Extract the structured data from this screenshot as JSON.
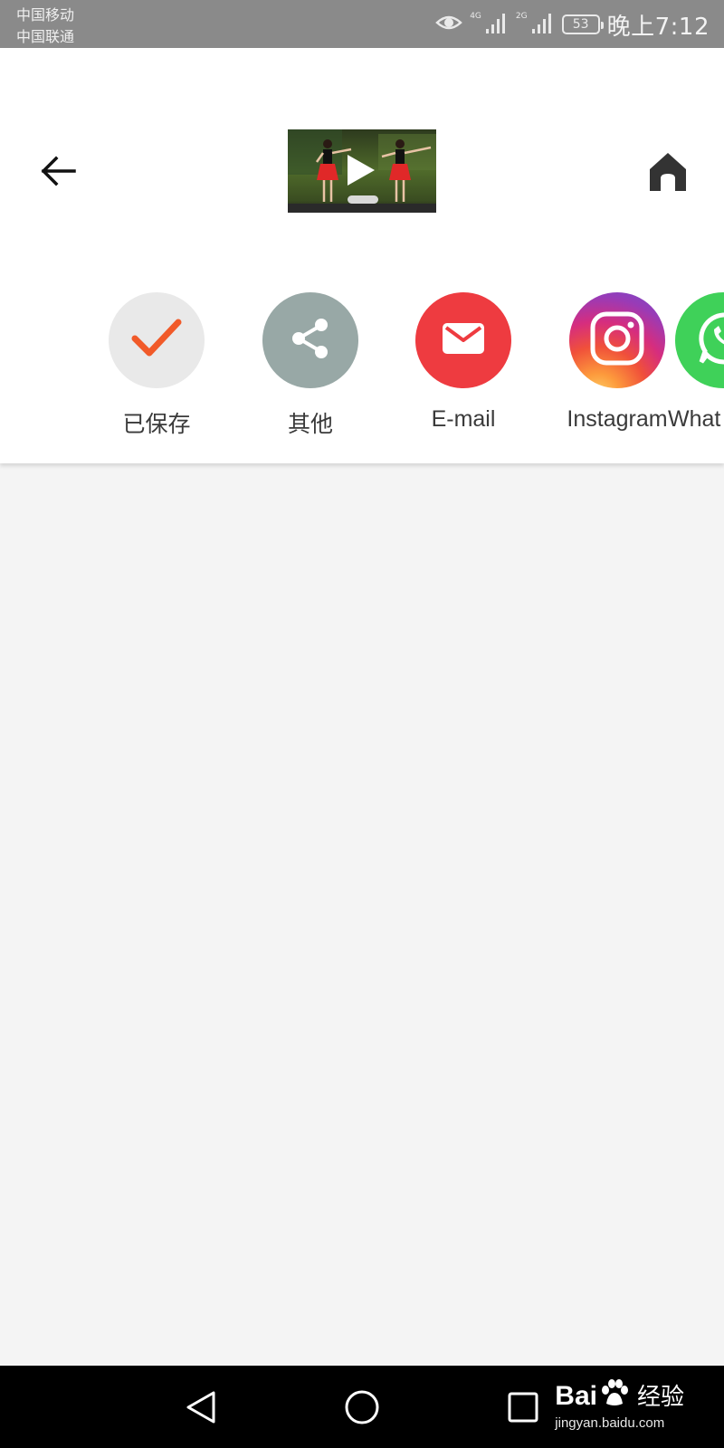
{
  "status_bar": {
    "carrier_1": "中国移动",
    "carrier_2": "中国联通",
    "network_1": "4G",
    "network_2": "2G",
    "battery": "53",
    "time": "晚上7:12",
    "icons": [
      "eye-icon",
      "signal-icon",
      "signal-icon",
      "battery-icon"
    ]
  },
  "header": {
    "back_icon": "arrow-left-icon",
    "home_icon": "home-icon",
    "thumbnail_icon": "play-icon"
  },
  "share_targets": [
    {
      "label": "已保存",
      "icon": "checkmark-icon",
      "color": "#e9e9e9",
      "icon_color": "#f15a29"
    },
    {
      "label": "其他",
      "icon": "share-icon",
      "color": "#98a8a6"
    },
    {
      "label": "E-mail",
      "icon": "mail-icon",
      "color": "#ee3b40"
    },
    {
      "label": "Instagram",
      "icon": "instagram-icon",
      "color": "#d62d7e"
    },
    {
      "label": "What",
      "icon": "whatsapp-icon",
      "color": "#3fd159"
    }
  ],
  "nav_bar": {
    "back": "triangle-back-icon",
    "home": "circle-home-icon",
    "recent": "square-recent-icon"
  },
  "watermark": {
    "brand_left": "Bai",
    "brand_right": "经验",
    "url": "jingyan.baidu.com"
  }
}
